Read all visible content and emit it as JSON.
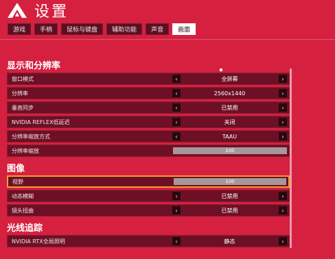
{
  "header": {
    "title": "设置"
  },
  "tabs": [
    "游戏",
    "手柄",
    "鼠标与键盘",
    "辅助功能",
    "声音",
    "画面"
  ],
  "sections": {
    "display": {
      "title": "显示和分辨率",
      "rows": [
        {
          "label": "窗口模式",
          "value": "全屏幕"
        },
        {
          "label": "分辨率",
          "value": "2560x1440"
        },
        {
          "label": "垂直同步",
          "value": "已禁用"
        },
        {
          "label": "NVIDIA REFLEX低延迟",
          "value": "关闭"
        },
        {
          "label": "分辨率缩放方式",
          "value": "TAAU"
        },
        {
          "label": "分辨率缩放",
          "value": "100"
        }
      ]
    },
    "image": {
      "title": "图像",
      "rows": [
        {
          "label": "视野",
          "value": "100"
        },
        {
          "label": "动态模糊",
          "value": "已禁用"
        },
        {
          "label": "镜头扭曲",
          "value": "已禁用"
        }
      ]
    },
    "raytracing": {
      "title": "光线追踪",
      "rows": [
        {
          "label": "NVIDIA RTX全局照明",
          "value": "静态"
        }
      ]
    }
  },
  "arrows": {
    "left": "‹",
    "right": "›"
  }
}
